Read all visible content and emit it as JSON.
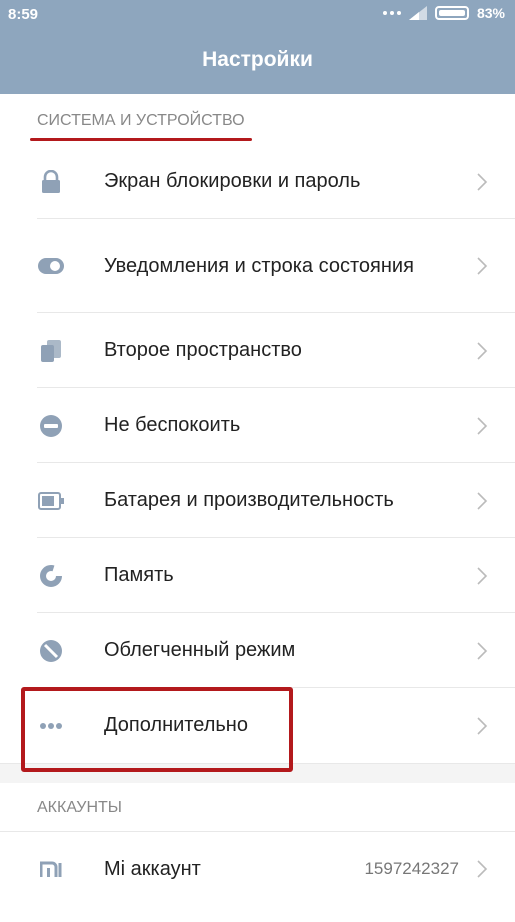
{
  "status_bar": {
    "time": "8:59",
    "battery": "83%"
  },
  "header": {
    "title": "Настройки"
  },
  "sections": {
    "system": {
      "title": "СИСТЕМА И УСТРОЙСТВО"
    },
    "accounts": {
      "title": "АККАУНТЫ"
    }
  },
  "items": [
    {
      "label": "Экран блокировки и пароль",
      "icon": "lock-icon"
    },
    {
      "label": "Уведомления и строка состояния",
      "icon": "toggle-icon"
    },
    {
      "label": "Второе пространство",
      "icon": "second-space-icon"
    },
    {
      "label": "Не беспокоить",
      "icon": "do-not-disturb-icon"
    },
    {
      "label": "Батарея и производительность",
      "icon": "battery-icon"
    },
    {
      "label": "Память",
      "icon": "storage-icon"
    },
    {
      "label": "Облегченный режим",
      "icon": "lite-mode-icon"
    },
    {
      "label": "Дополнительно",
      "icon": "more-dots-icon"
    }
  ],
  "account": {
    "label": "Mi аккаунт",
    "value": "1597242327",
    "icon": "mi-logo-icon"
  },
  "colors": {
    "header_bg": "#8ea6be",
    "icon": "#8fa1b6",
    "highlight": "#b3191c"
  }
}
